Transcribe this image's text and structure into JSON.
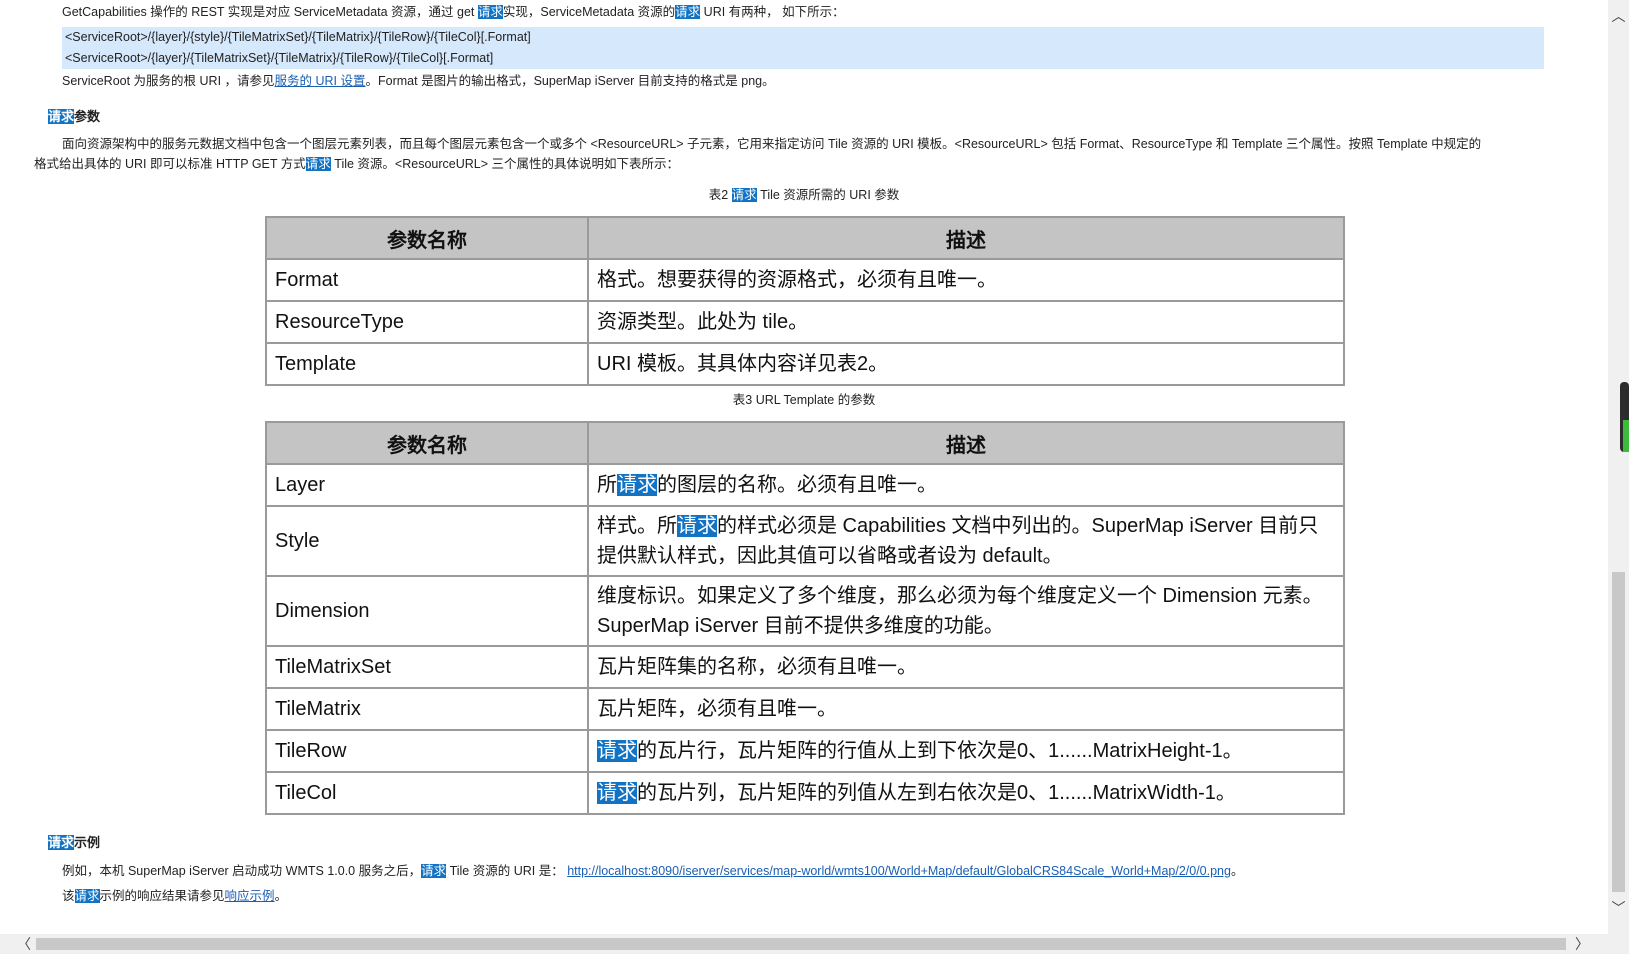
{
  "intro": {
    "p1_a": "GetCapabilities 操作的 REST 实现是对应 ServiceMetadata 资源，通过 get ",
    "p1_hl1": "请求",
    "p1_b": "实现，ServiceMetadata 资源的",
    "p1_hl2": "请求",
    "p1_c": " URI 有两种， 如下所示：",
    "code_lines": [
      "<ServiceRoot>/{layer}/{style}/{TileMatrixSet}/{TileMatrix}/{TileRow}/{TileCol}[.Format]",
      "<ServiceRoot>/{layer}/{TileMatrixSet}/{TileMatrix}/{TileRow}/{TileCol}[.Format]"
    ],
    "p2_a": "ServiceRoot 为服务的根 URI ，请参见",
    "p2_link": "服务的 URI 设置",
    "p2_b": "。Format 是图片的输出格式，SuperMap iServer 目前支持的格式是 png。"
  },
  "section_params": {
    "heading_hl": "请求",
    "heading_rest": "参数",
    "para_line1": "面向资源架构中的服务元数据文档中包含一个图层元素列表，而且每个图层元素包含一个或多个 <ResourceURL> 子元素，它用来指定访问 Tile 资源的 URI 模板。<ResourceURL> 包括 Format、ResourceType 和 Template 三个属性。按照 Template 中规定的",
    "para_line2_a": "格式给出具体的 URI 即可以标准 HTTP GET 方式",
    "para_line2_hl": "请求",
    "para_line2_b": " Tile 资源。<ResourceURL> 三个属性的具体说明如下表所示："
  },
  "table2": {
    "caption_a": "表2 ",
    "caption_hl": "请求",
    "caption_b": " Tile 资源所需的 URI 参数",
    "headers": [
      "参数名称",
      "描述"
    ],
    "rows": [
      {
        "name": "Format",
        "desc": "格式。想要获得的资源格式，必须有且唯一。"
      },
      {
        "name": "ResourceType",
        "desc": "资源类型。此处为 tile。"
      },
      {
        "name": "Template",
        "desc": "URI 模板。其具体内容详见表2。"
      }
    ]
  },
  "table3": {
    "caption": "表3 URL Template 的参数",
    "headers": [
      "参数名称",
      "描述"
    ],
    "rows": [
      {
        "name": "Layer",
        "desc_pre": "所",
        "desc_hl": "请求",
        "desc_post": "的图层的名称。必须有且唯一。"
      },
      {
        "name": "Style",
        "desc_pre": "样式。所",
        "desc_hl": "请求",
        "desc_post": "的样式必须是 Capabilities 文档中列出的。SuperMap iServer 目前只提供默认样式，因此其值可以省略或者设为 default。"
      },
      {
        "name": "Dimension",
        "desc_pre": "维度标识。如果定义了多个维度，那么必须为每个维度定义一个 Dimension 元素。SuperMap iServer 目前不提供多维度的功能。",
        "desc_hl": "",
        "desc_post": ""
      },
      {
        "name": "TileMatrixSet",
        "desc_pre": "瓦片矩阵集的名称，必须有且唯一。",
        "desc_hl": "",
        "desc_post": ""
      },
      {
        "name": "TileMatrix",
        "desc_pre": "瓦片矩阵，必须有且唯一。",
        "desc_hl": "",
        "desc_post": ""
      },
      {
        "name": "TileRow",
        "desc_pre": "",
        "desc_hl": "请求",
        "desc_post": "的瓦片行，瓦片矩阵的行值从上到下依次是0、1......MatrixHeight-1。"
      },
      {
        "name": "TileCol",
        "desc_pre": "",
        "desc_hl": "请求",
        "desc_post": "的瓦片列，瓦片矩阵的列值从左到右依次是0、1......MatrixWidth-1。"
      }
    ]
  },
  "section_example": {
    "heading_hl": "请求",
    "heading_rest": "示例",
    "line1_a": "例如，本机 SuperMap iServer 启动成功 WMTS 1.0.0 服务之后，",
    "line1_hl": "请求",
    "line1_b": " Tile 资源的 URI 是： ",
    "line1_link": "http://localhost:8090/iserver/services/map-world/wmts100/World+Map/default/GlobalCRS84Scale_World+Map/2/0/0.png",
    "line1_end": "。",
    "line2_a": "该",
    "line2_hl": "请求",
    "line2_b": "示例的响应结果请参见",
    "line2_link": "响应示例",
    "line2_end": "。"
  },
  "scrollbar": {
    "up": "︿",
    "down": "﹀",
    "left": "〈",
    "right": "〉"
  }
}
